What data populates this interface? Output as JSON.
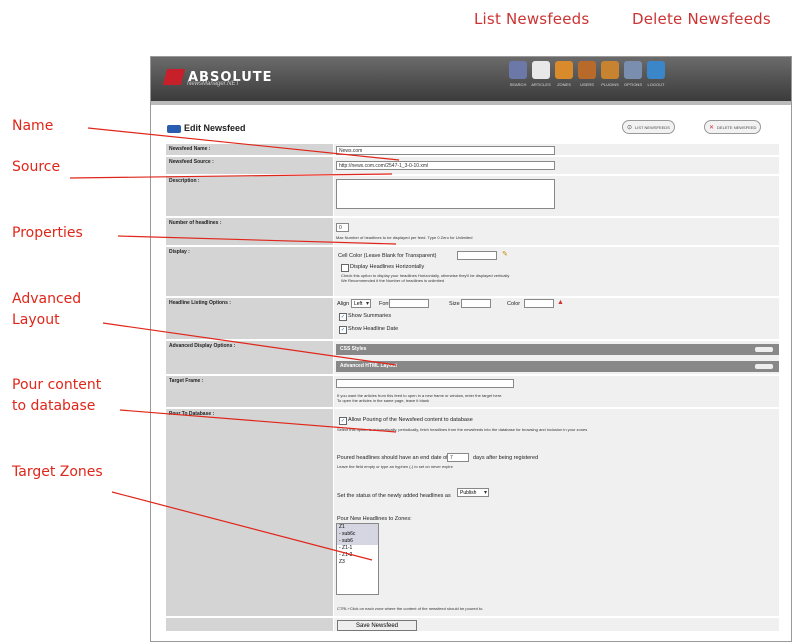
{
  "top_links": {
    "list": "List Newsfeeds",
    "delete": "Delete Newsfeeds"
  },
  "annotations": {
    "name": "Name",
    "source": "Source",
    "properties": "Properties",
    "advanced_layout": "Advanced\nLayout",
    "pour_content": "Pour content\nto database",
    "target_zones": "Target Zones"
  },
  "app": {
    "logo": "ABSOLUTE",
    "logo_sub": "NewsManager.NET",
    "toolbar": [
      {
        "icon": "search-icon",
        "label": "SEARCH",
        "color": "#6b78a8"
      },
      {
        "icon": "articles-icon",
        "label": "ARTICLES",
        "color": "#e8e8e8"
      },
      {
        "icon": "zones-icon",
        "label": "ZONES",
        "color": "#d98a2a"
      },
      {
        "icon": "users-icon",
        "label": "USERS",
        "color": "#b86a2a"
      },
      {
        "icon": "plugins-icon",
        "label": "PLUGINS",
        "color": "#c7832f"
      },
      {
        "icon": "options-icon",
        "label": "OPTIONS",
        "color": "#7a8fb0"
      },
      {
        "icon": "logout-icon",
        "label": "LOGOUT",
        "color": "#3a86c8"
      }
    ]
  },
  "form": {
    "title": "Edit Newsfeed",
    "list_btn": "LIST NEWSFEEDS",
    "delete_btn": "DELETE NEWSFEED",
    "name_label": "Newsfeed Name :",
    "name_value": "News.com",
    "source_label": "Newsfeed Source :",
    "source_value": "http://news.com.com/2547-1_3-0-10.xml",
    "description_label": "Description :",
    "num_headlines_label": "Number of headlines :",
    "num_headlines_value": "0",
    "num_headlines_help": "Max Number of headlines to be displayed per feed. Type 0 Zero for Unlimited",
    "display_label": "Display :",
    "cell_color": "Cell Color (Leave Blank for Transparent)",
    "display_horiz": "Display Headlines Horizontally",
    "display_help1": "Check this option to display your headlines Horizontally, otherwise they'll be displayed vertically",
    "display_help2": "We Recommended it the Number of headlines is unlimited",
    "listing_label": "Headline Listing Options :",
    "align_label": "Align :",
    "align_value": "Left",
    "font_label": "Font",
    "size_label": "Size",
    "color_label": "Color",
    "show_summaries": "Show Summaries",
    "show_date": "Show Headline Date",
    "advanced_label": "Advanced Display Options :",
    "css_styles": "CSS Styles",
    "adv_html": "Advanced HTML Layout",
    "target_label": "Target Frame :",
    "target_help1": "If you want the articles from this feed to open in a new frame or window, enter the target here.",
    "target_help2": "To open the articles in the same page, leave it blank",
    "pour_label": "Pour To Database :",
    "allow_pouring": "Allow Pouring of the Newsfeed content to database",
    "pour_help": "Select this option to automatically, periodically, fetch headlines from the newsfeeds into the database for browsing and inclusion in your zones",
    "end_date_pre": "Poured headlines should have an end date of",
    "end_date_value": "7",
    "end_date_post": "days after being registered",
    "end_date_help": "Leave the field empty or type an hyphen (-) to set on never expire",
    "status_pre": "Set the status of the newly added headlines as",
    "status_value": "Publish",
    "zones_label": "Pour New Headlines to Zones:",
    "zones": [
      "Z1",
      "- sub6c",
      "- sub6",
      "- Z1-1",
      "- Z1-2",
      "Z3"
    ],
    "zones_help": "CTRL+Click on each zone where the content of the newsfeed should be poured to.",
    "save_btn": "Save Newsfeed"
  }
}
